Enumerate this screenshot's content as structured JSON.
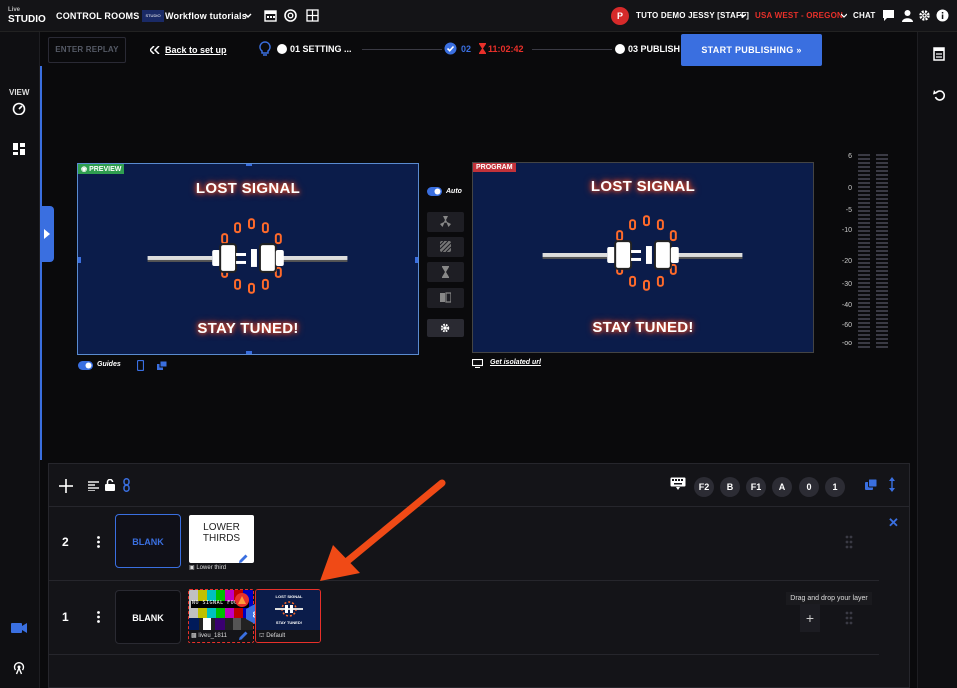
{
  "topbar": {
    "logo_top": "Live",
    "logo_main": "STUDIO",
    "control_rooms": "CONTROL ROOMS",
    "project_thumb": "STUDIO",
    "project_name": "Workflow tutorials",
    "avatar_initial": "P",
    "user_name": "TUTO DEMO JESSY [STAFF]",
    "region": "USA WEST - OREGON",
    "chat": "CHAT"
  },
  "leftbar": {
    "view_label": "VIEW"
  },
  "stepper": {
    "enter_replay": "ENTER REPLAY",
    "back_to_setup": "Back to set up",
    "step1": "01 SETTING ...",
    "step2_num": "02",
    "step2_timer": "11:02:42",
    "step3": "03 PUBLISH",
    "start_publishing": "START PUBLISHING"
  },
  "preview": {
    "tag": "PREVIEW",
    "line1": "LOST SIGNAL",
    "line2": "STAY TUNED!",
    "guides_label": "Guides"
  },
  "program": {
    "tag": "PROGRAM",
    "line1": "LOST SIGNAL",
    "line2": "STAY TUNED!",
    "isolated_url": "Get isolated url"
  },
  "controls": {
    "auto_label": "Auto"
  },
  "vu_meter": {
    "labels": [
      "6",
      "0",
      "-5",
      "-10",
      "-20",
      "-30",
      "-40",
      "-60",
      "-oo"
    ]
  },
  "layers_toolbar": {
    "shortcuts": [
      "F2",
      "B",
      "F1",
      "A",
      "0",
      "1"
    ]
  },
  "layers": {
    "row2": {
      "number": "2",
      "blank": "BLANK",
      "lower_thirds_line1": "LOWER",
      "lower_thirds_line2": "THIRDS",
      "lower_third_caption": "Lower third"
    },
    "row1": {
      "number": "1",
      "blank": "BLANK",
      "source_caption": "liveu_1811",
      "default_caption": "Default",
      "badge_num": "8",
      "tooltip": "Drag and drop your layer",
      "bars_text": "NO SIGNAL FOU"
    }
  },
  "colors": {
    "accent": "#3a6fe0",
    "danger": "#e8302a",
    "arrow": "#f04a16",
    "preview_tag": "#2f9e50",
    "program_tag": "#c2323a"
  }
}
